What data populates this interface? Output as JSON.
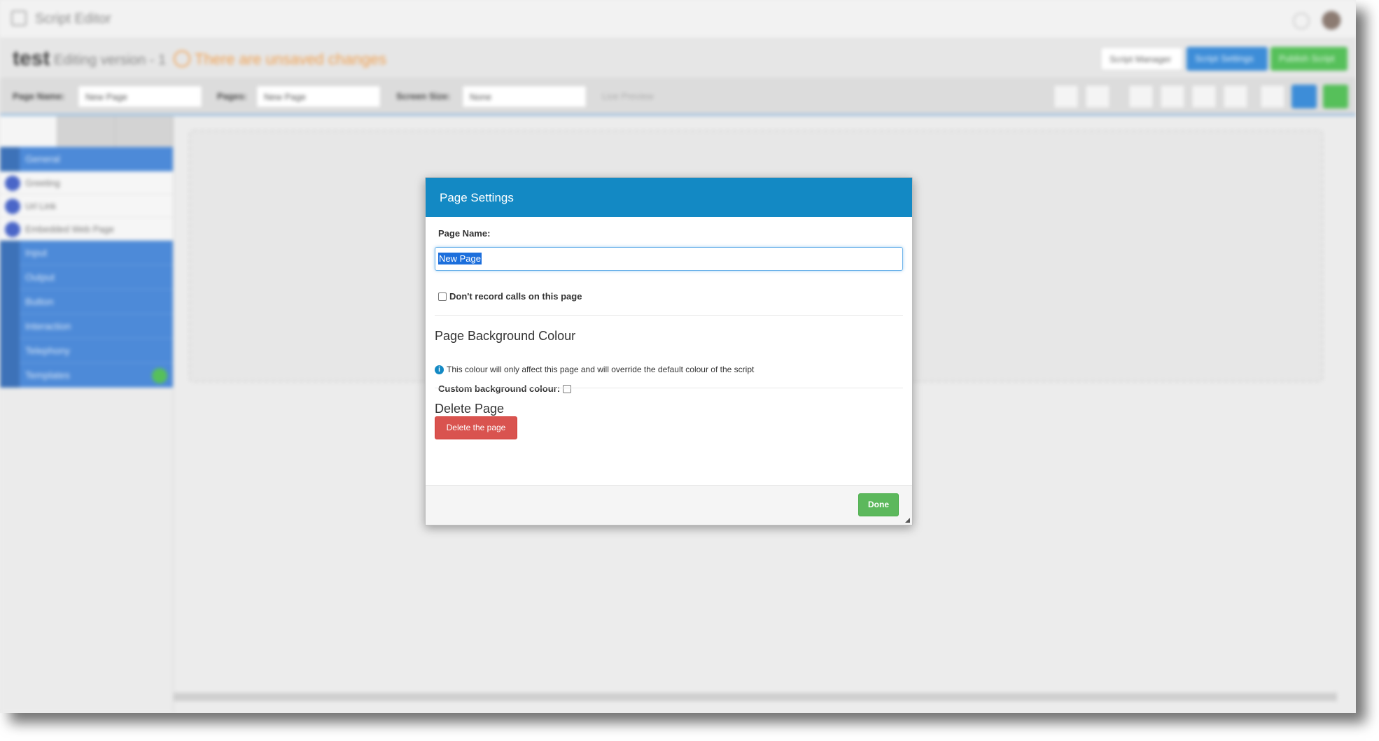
{
  "app": {
    "title": "Script Editor"
  },
  "header": {
    "script_name": "test",
    "version_text": "Editing version - 1",
    "unsaved_text": "There are unsaved changes",
    "script_manager_label": "Script Manager",
    "script_settings_label": "Script Settings",
    "publish_label": "Publish Script"
  },
  "toolbar": {
    "page_name_label": "Page Name:",
    "page_name_value": "New Page",
    "pages_label": "Pages:",
    "pages_value": "New Page",
    "screen_size_label": "Screen Size:",
    "screen_size_value": "None",
    "live_preview_label": "Live Preview"
  },
  "sidebar": {
    "categories": [
      {
        "label": "General"
      },
      {
        "label": "Input"
      },
      {
        "label": "Output"
      },
      {
        "label": "Button"
      },
      {
        "label": "Interaction"
      },
      {
        "label": "Telephony"
      },
      {
        "label": "Templates"
      }
    ],
    "general_items": [
      {
        "label": "Greeting"
      },
      {
        "label": "Url Link"
      },
      {
        "label": "Embedded Web Page"
      }
    ]
  },
  "modal": {
    "title": "Page Settings",
    "page_name_label": "Page Name:",
    "page_name_value": "New Page",
    "dont_record_label": "Don't record calls on this page",
    "bg_section_title": "Page Background Colour",
    "bg_info_text": "This colour will only affect this page and will override the default colour of the script",
    "custom_bg_label": "Custom background colour:",
    "delete_section_title": "Delete Page",
    "delete_button_label": "Delete the page",
    "done_button_label": "Done"
  },
  "colors": {
    "modal_header": "#1389c4",
    "delete_button": "#d9534f",
    "done_button": "#5cb85c",
    "sidebar_category": "#4d8ad8",
    "warning": "#f0a050"
  }
}
